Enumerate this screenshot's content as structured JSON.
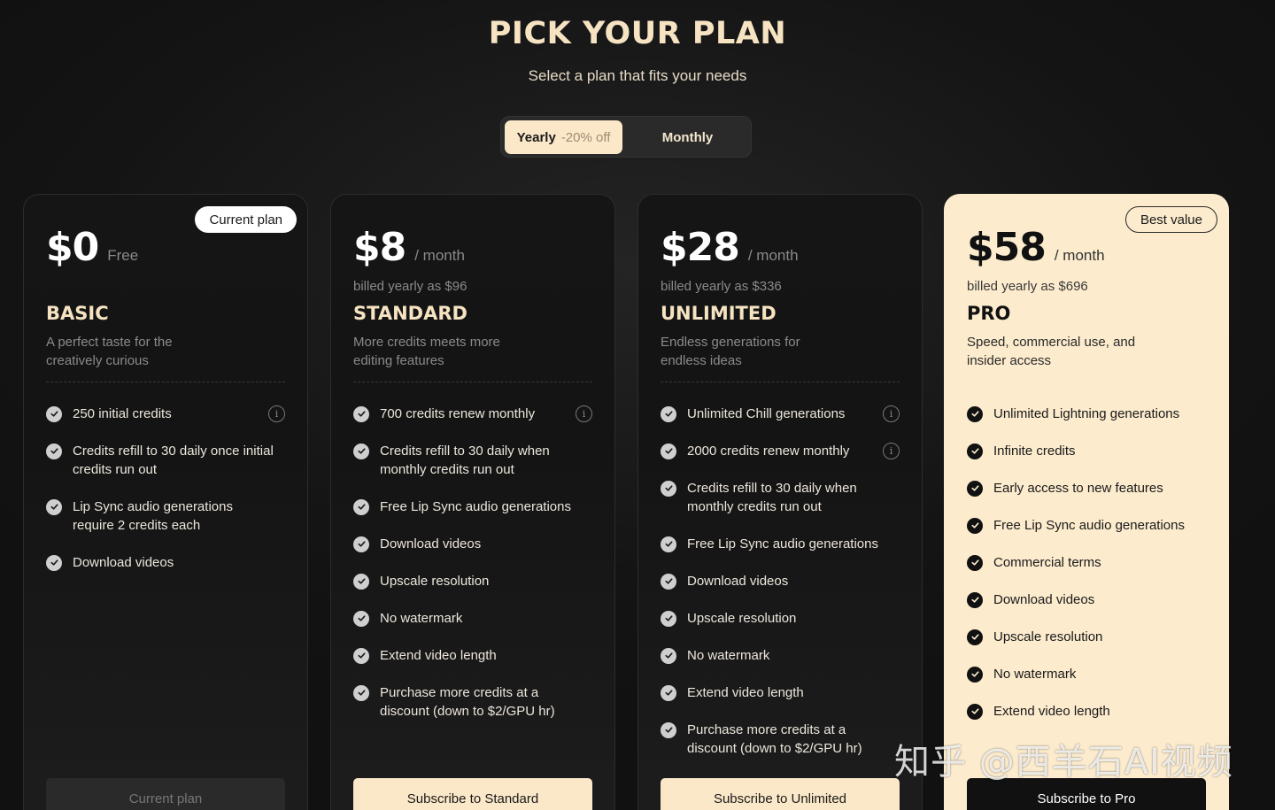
{
  "header": {
    "title": "PICK YOUR PLAN",
    "subtitle": "Select a plan that fits your needs"
  },
  "billing_toggle": {
    "yearly_label": "Yearly",
    "yearly_discount": "-20% off",
    "monthly_label": "Monthly",
    "selected": "Yearly"
  },
  "plans": [
    {
      "badge": "Current plan",
      "price": "$0",
      "period": "Free",
      "billed": "",
      "name": "BASIC",
      "description": "A perfect taste for the creatively curious",
      "features": [
        {
          "text": "250 initial credits",
          "info": true
        },
        {
          "text": "Credits refill to 30 daily once initial credits run out",
          "info": false
        },
        {
          "text": "Lip Sync audio generations require 2 credits each",
          "info": false
        },
        {
          "text": "Download videos",
          "info": false
        }
      ],
      "cta": "Current plan"
    },
    {
      "badge": "",
      "price": "$8",
      "period": "/ month",
      "billed": "billed yearly as $96",
      "name": "STANDARD",
      "description": "More credits meets more editing features",
      "features": [
        {
          "text": "700 credits renew monthly",
          "info": true
        },
        {
          "text": "Credits refill to 30 daily when monthly credits run out",
          "info": false
        },
        {
          "text": "Free Lip Sync audio generations",
          "info": false
        },
        {
          "text": "Download videos",
          "info": false
        },
        {
          "text": "Upscale resolution",
          "info": false
        },
        {
          "text": "No watermark",
          "info": false
        },
        {
          "text": "Extend video length",
          "info": false
        },
        {
          "text": "Purchase more credits at a discount (down to $2/GPU hr)",
          "info": false
        }
      ],
      "cta": "Subscribe to Standard"
    },
    {
      "badge": "",
      "price": "$28",
      "period": "/ month",
      "billed": "billed yearly as $336",
      "name": "UNLIMITED",
      "description": "Endless generations for endless ideas",
      "features": [
        {
          "text": "Unlimited Chill generations",
          "info": true
        },
        {
          "text": "2000 credits renew monthly",
          "info": true
        },
        {
          "text": "Credits refill to 30 daily when monthly credits run out",
          "info": false
        },
        {
          "text": "Free Lip Sync audio generations",
          "info": false
        },
        {
          "text": "Download videos",
          "info": false
        },
        {
          "text": "Upscale resolution",
          "info": false
        },
        {
          "text": "No watermark",
          "info": false
        },
        {
          "text": "Extend video length",
          "info": false
        },
        {
          "text": "Purchase more credits at a discount (down to $2/GPU hr)",
          "info": false
        }
      ],
      "cta": "Subscribe to Unlimited"
    },
    {
      "badge": "Best value",
      "price": "$58",
      "period": "/ month",
      "billed": "billed yearly as $696",
      "name": "PRO",
      "description": "Speed, commercial use, and insider access",
      "features": [
        {
          "text": "Unlimited Lightning generations",
          "info": false
        },
        {
          "text": "Infinite credits",
          "info": false
        },
        {
          "text": "Early access to new features",
          "info": false
        },
        {
          "text": "Free Lip Sync audio generations",
          "info": false
        },
        {
          "text": "Commercial terms",
          "info": false
        },
        {
          "text": "Download videos",
          "info": false
        },
        {
          "text": "Upscale resolution",
          "info": false
        },
        {
          "text": "No watermark",
          "info": false
        },
        {
          "text": "Extend video length",
          "info": false
        }
      ],
      "cta": "Subscribe to Pro"
    }
  ],
  "watermark": "知乎 @西羊石AI视频",
  "colors": {
    "background": "#141414",
    "accent": "#fbe8c8",
    "title": "#f6e3c2",
    "pro_card": "#fcebcd"
  }
}
